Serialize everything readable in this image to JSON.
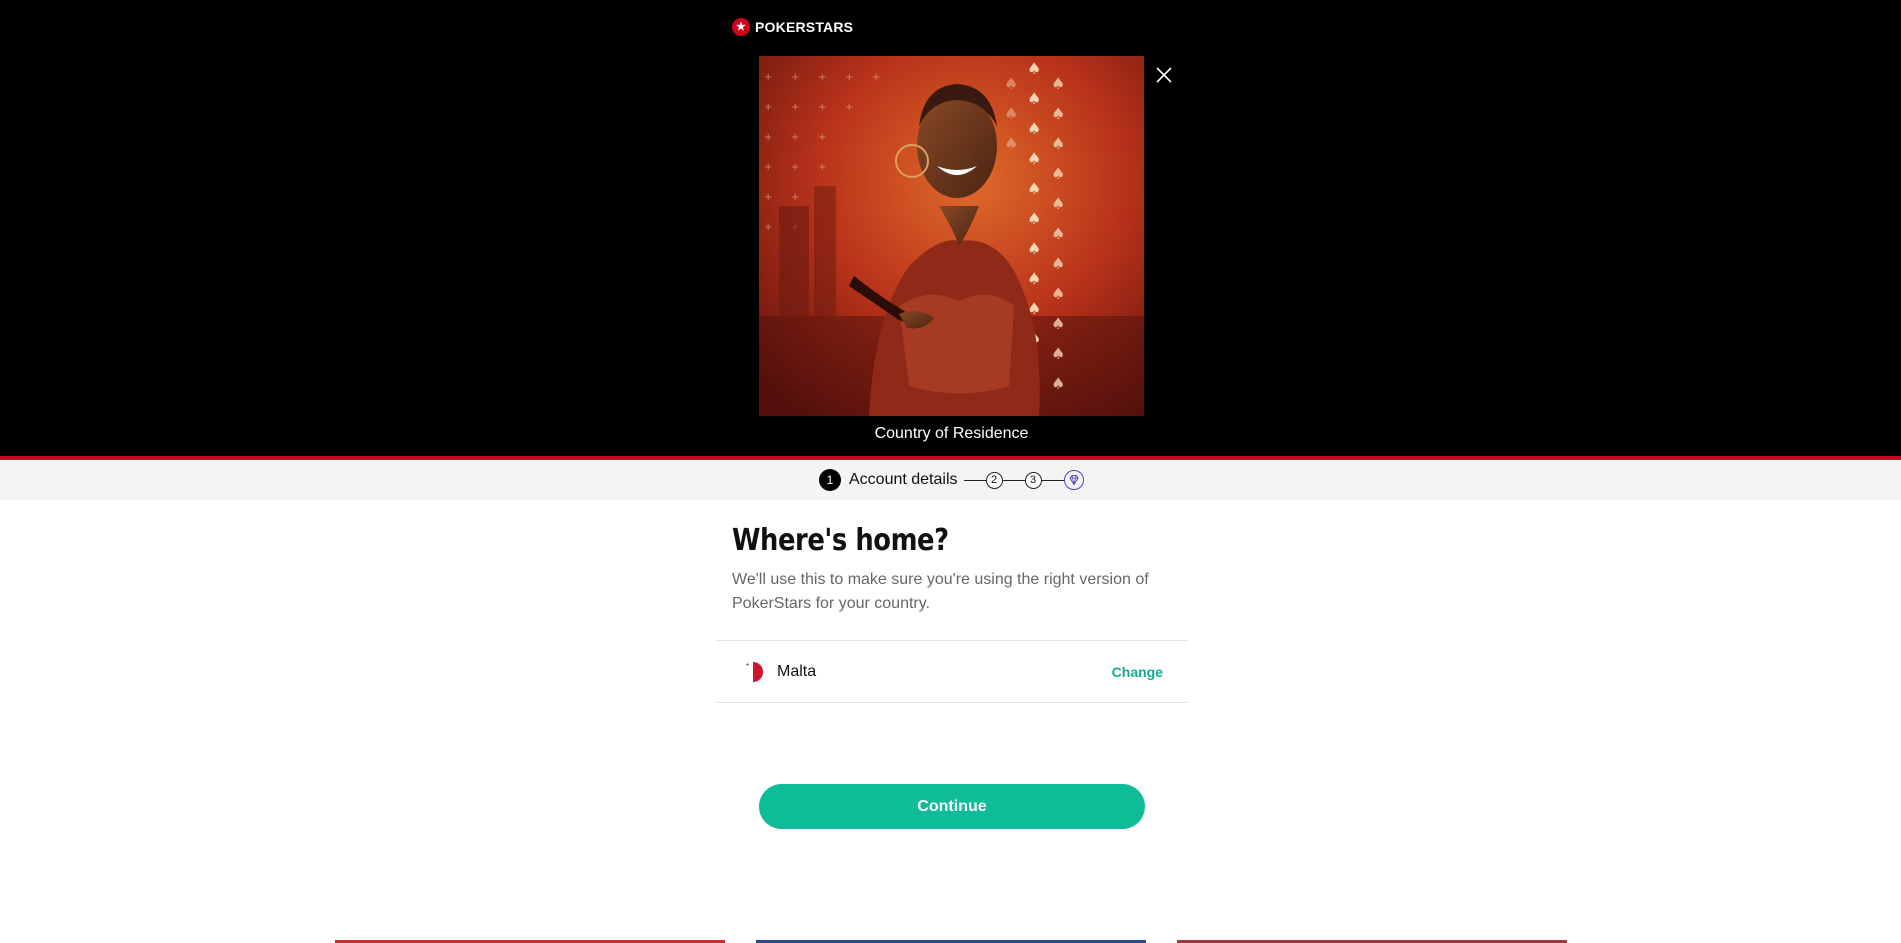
{
  "header": {
    "brand": "POKERSTARS",
    "hero_alt": "Smiling woman holding a phone on a red spade-patterned background"
  },
  "hero": {
    "caption": "Country of Residence"
  },
  "stepper": {
    "active_step": "1",
    "active_label": "Account details",
    "step_2": "2",
    "step_3": "3"
  },
  "main": {
    "heading": "Where's home?",
    "subtext": "We'll use this to make sure you're using the right version of PokerStars for your country.",
    "country": "Malta",
    "change_label": "Change",
    "continue_label": "Continue"
  },
  "colors": {
    "accent": "#0fbc98",
    "brand_red": "#d0021b",
    "stepper_gem": "#5a3fb8"
  },
  "icons": [
    "pokerstars-logo-icon",
    "close-icon",
    "diamond-icon",
    "malta-flag-icon"
  ]
}
